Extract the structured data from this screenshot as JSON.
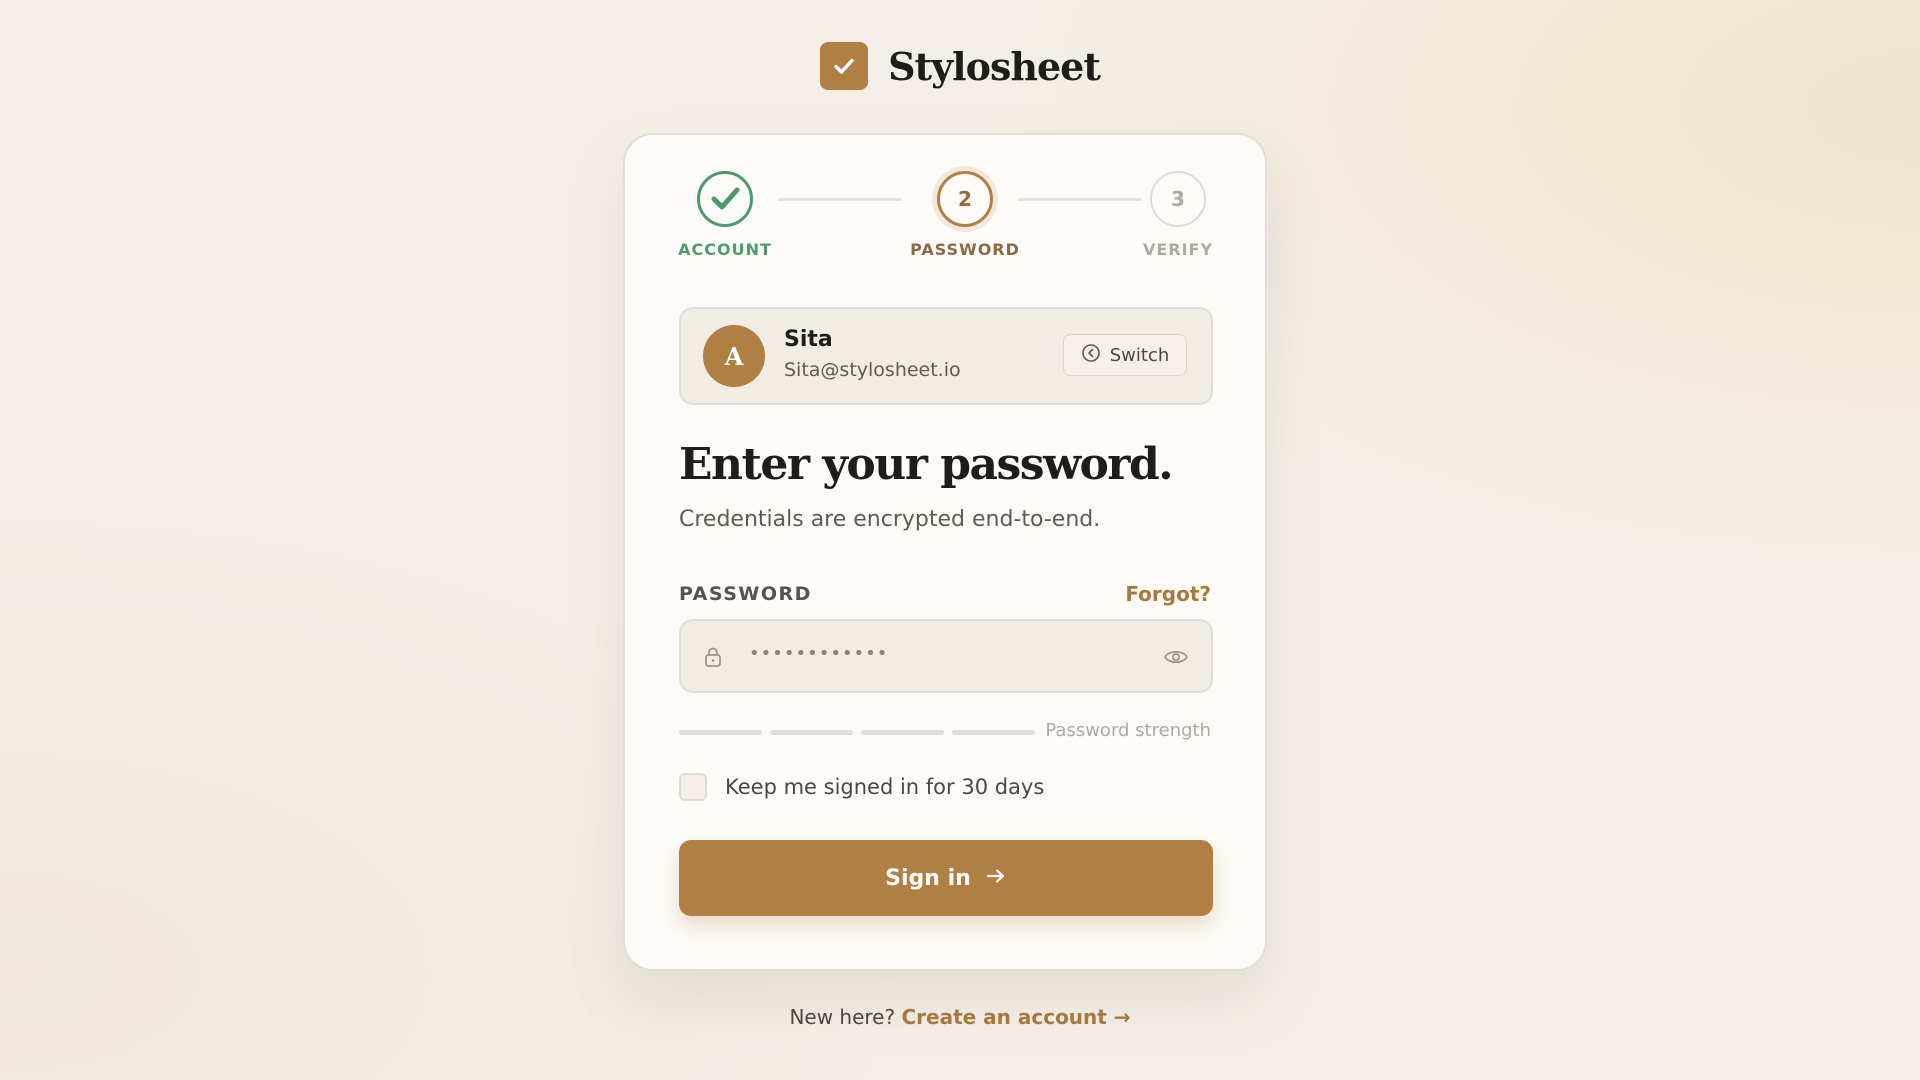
{
  "brand": {
    "name": "Stylosheet",
    "icon": "check-icon",
    "color": "#b07f43"
  },
  "stepper": {
    "steps": [
      {
        "number": "1",
        "label": "ACCOUNT",
        "state": "complete",
        "color": "#4e9a6c"
      },
      {
        "number": "2",
        "label": "PASSWORD",
        "state": "current",
        "color": "#b07f43"
      },
      {
        "number": "3",
        "label": "VERIFY",
        "state": "upcoming",
        "color": "#b0a99f"
      }
    ]
  },
  "account": {
    "initial": "A",
    "name": "Sita",
    "email": "Sita@stylosheet.io",
    "switch_label": "Switch",
    "switch_icon": "chevron-left-circle-icon"
  },
  "heading": {
    "title": "Enter your password.",
    "subtitle": "Credentials are encrypted end-to-end."
  },
  "password": {
    "label": "PASSWORD",
    "forgot_label": "Forgot?",
    "value": "••••••••••••",
    "strength_label": "Password strength",
    "strength_filled": 0,
    "strength_segments": 4,
    "icons": {
      "lock": "lock-icon",
      "reveal": "eye-icon"
    }
  },
  "remember": {
    "label": "Keep me signed in for 30 days",
    "checked": false
  },
  "submit": {
    "label": "Sign in",
    "icon": "arrow-right-icon"
  },
  "footer": {
    "prompt": "New here?",
    "link": "Create an account →"
  }
}
